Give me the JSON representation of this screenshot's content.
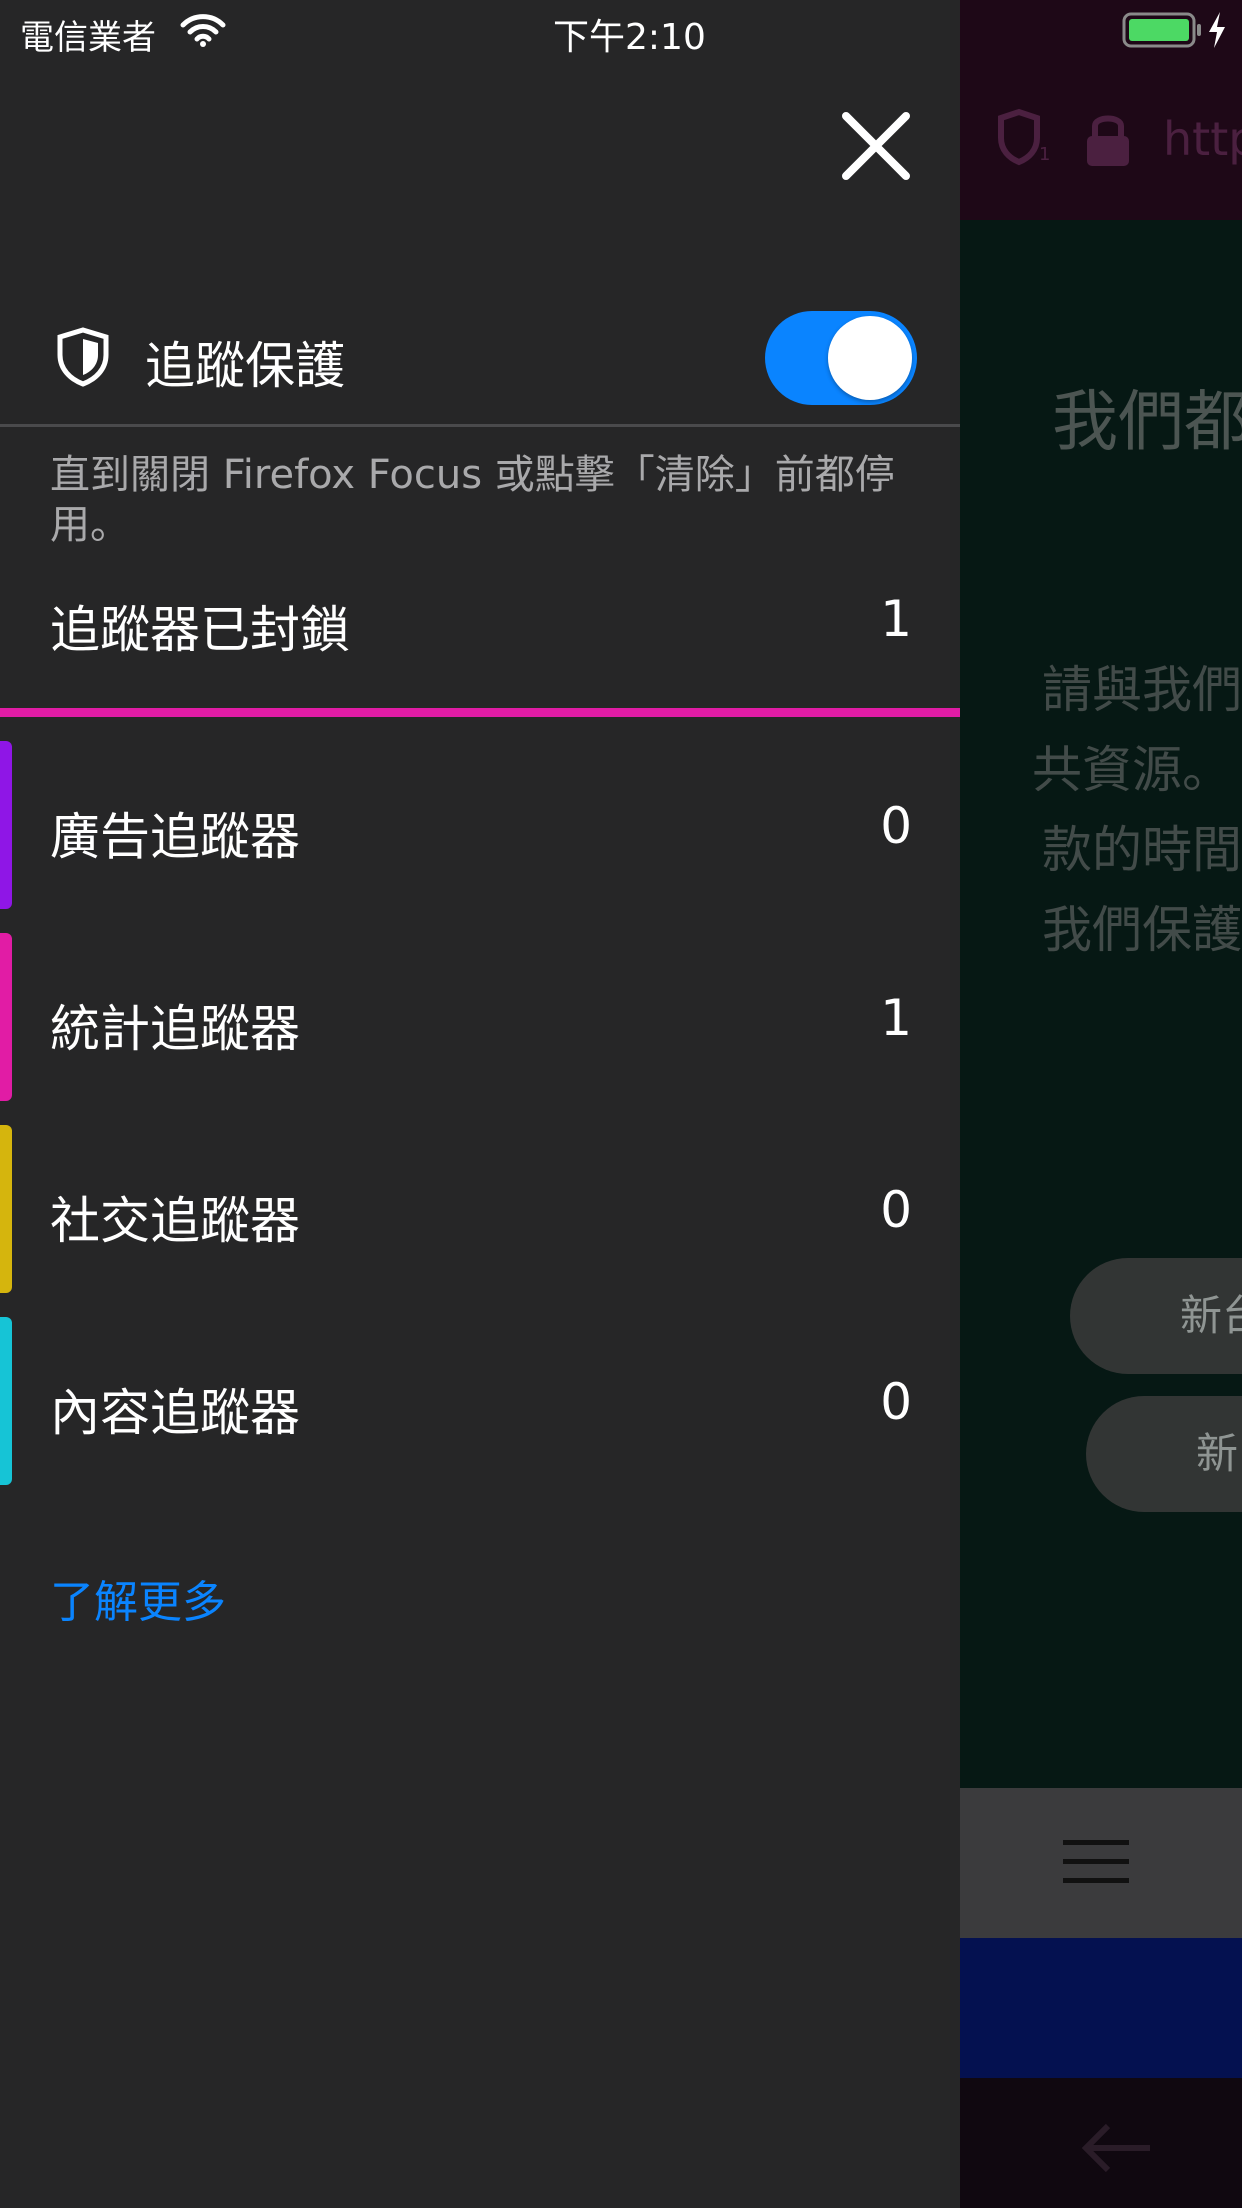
{
  "status_bar": {
    "carrier": "電信業者",
    "time": "下午2:10"
  },
  "panel": {
    "tracking_protection_title": "追蹤保護",
    "toggle_on": true,
    "description": "直到關閉 Firefox Focus 或點擊「清除」前都停用。",
    "blocked": {
      "label": "追蹤器已封鎖",
      "count": "1"
    },
    "categories": [
      {
        "label": "廣告追蹤器",
        "count": "0",
        "color": "#8f16e6"
      },
      {
        "label": "統計追蹤器",
        "count": "1",
        "color": "#e11ca5"
      },
      {
        "label": "社交追蹤器",
        "count": "0",
        "color": "#d5b50d"
      },
      {
        "label": "內容追蹤器",
        "count": "0",
        "color": "#16c4d6"
      }
    ],
    "learn_more": "了解更多"
  },
  "background_page": {
    "url_fragment": "http",
    "headline": "我們都",
    "paragraph_lines": [
      "請與我們",
      "共資源。",
      "款的時間",
      "我們保護"
    ],
    "button_1": "新台",
    "button_2": "新"
  },
  "colors": {
    "accent_blue": "#0a84ff",
    "panel_bg": "#262627",
    "magenta": "#e11ca5"
  }
}
